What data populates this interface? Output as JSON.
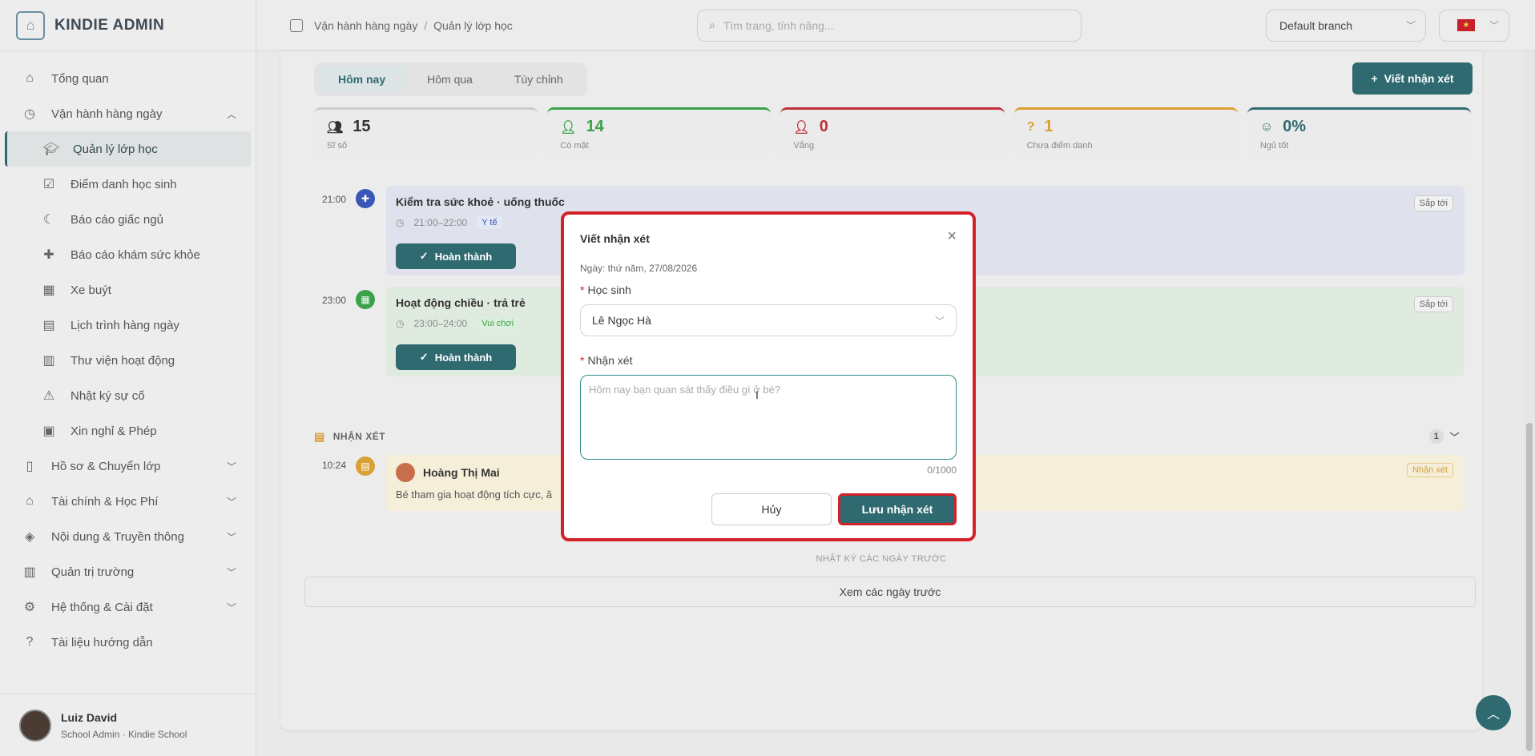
{
  "brand": {
    "name": "KINDIE ADMIN",
    "logo_icon": "school-icon"
  },
  "sidebar": {
    "items": [
      {
        "label": "Tổng quan",
        "icon": "home-icon"
      },
      {
        "label": "Vận hành hàng ngày",
        "icon": "clock-icon",
        "expanded": true
      },
      {
        "label": "Quản lý lớp học",
        "icon": "graduation-cap-icon",
        "active": true
      },
      {
        "label": "Điểm danh học sinh",
        "icon": "checkbox-icon"
      },
      {
        "label": "Báo cáo giấc ngủ",
        "icon": "moon-icon"
      },
      {
        "label": "Báo cáo khám sức khỏe",
        "icon": "plus-cross-icon"
      },
      {
        "label": "Xe buýt",
        "icon": "bus-icon"
      },
      {
        "label": "Lịch trình hàng ngày",
        "icon": "calendar-icon"
      },
      {
        "label": "Thư viện hoạt động",
        "icon": "book-icon"
      },
      {
        "label": "Nhật ký sự cố",
        "icon": "warning-icon"
      },
      {
        "label": "Xin nghỉ & Phép",
        "icon": "calendar-clock-icon"
      },
      {
        "label": "Hồ sơ & Chuyển lớp",
        "icon": "clipboard-icon"
      },
      {
        "label": "Tài chính & Học Phí",
        "icon": "bank-icon"
      },
      {
        "label": "Nội dung & Truyền thông",
        "icon": "layers-icon"
      },
      {
        "label": "Quản trị trường",
        "icon": "building-icon"
      },
      {
        "label": "Hệ thống & Cài đặt",
        "icon": "gear-icon"
      },
      {
        "label": "Tài liệu hướng dẫn",
        "icon": "help-icon"
      }
    ]
  },
  "user": {
    "name": "Luiz David",
    "role": "School Admin · Kindie School"
  },
  "topbar": {
    "breadcrumb": [
      "Vận hành hàng ngày",
      "Quản lý lớp học"
    ],
    "search_placeholder": "Tìm trang, tính năng...",
    "branch": "Default branch"
  },
  "main": {
    "tabs": [
      "Hôm nay",
      "Hôm qua",
      "Tùy chỉnh"
    ],
    "write_button": "Viết nhận xét",
    "stats": [
      {
        "value": "15",
        "label": "Sĩ số",
        "color": "#444444"
      },
      {
        "value": "14",
        "label": "Có mặt",
        "color": "#3aa34a"
      },
      {
        "value": "0",
        "label": "Vắng",
        "color": "#c0303a"
      },
      {
        "value": "1",
        "label": "Chưa điểm danh",
        "color": "#d9a036"
      },
      {
        "value": "0%",
        "label": "Ngủ tốt",
        "color": "#2f6a70"
      }
    ],
    "timeline": [
      {
        "time": "21:00",
        "title": "Kiểm tra sức khoẻ · uống thuốc",
        "range": "21:00–22:00",
        "tag": "Y tế",
        "done": "Hoàn thành",
        "badge": "Sắp tới"
      },
      {
        "time": "23:00",
        "title": "Hoạt động chiều · trả trẻ",
        "range": "23:00–24:00",
        "tag": "Vui chơi",
        "done": "Hoàn thành",
        "badge": "Sắp tới"
      }
    ],
    "notes": {
      "header": "NHẬN XÉT",
      "count": "1",
      "time": "10:24",
      "author": "Hoàng Thị Mai",
      "text": "Bé tham gia hoạt động tích cực, ă",
      "badge": "Nhận xét"
    },
    "prev_label": "NHẬT KÝ CÁC NGÀY TRƯỚC",
    "prev_button": "Xem các ngày trước"
  },
  "modal": {
    "title": "Viết nhận xét",
    "date": "Ngày: thứ năm, 27/08/2026",
    "student_label": "Học sinh",
    "student_value": "Lê Ngọc Hà",
    "comment_label": "Nhận xét",
    "comment_placeholder": "Hôm nay bạn quan sát thấy điều gì ở bé?",
    "counter": "0/1000",
    "cancel": "Hủy",
    "save": "Lưu nhận xét"
  }
}
